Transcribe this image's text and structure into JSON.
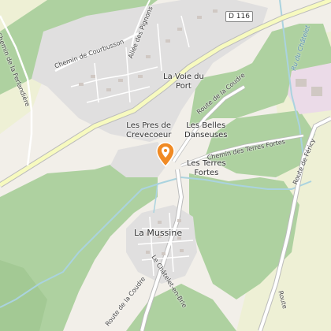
{
  "map": {
    "places": {
      "la_voie_du_port": "La Voie du\nPort",
      "les_pres_de_crevecoeur": "Les Pres de\nCrevecoeur",
      "les_belles_danseuses": "Les Belles\nDanseuses",
      "les_terres_fortes": "Les Terres\nFortes",
      "la_mussine": "La Mussine"
    },
    "roads": {
      "d116": "D 116",
      "chemin_ferlandiere": "Chemin de la Ferlandière",
      "allee_pignons": "Allée des Pignons",
      "chemin_courbusson": "Chemin de Courbusson",
      "route_coudre_upper": "Route de la Coudre",
      "route_coudre_lower": "Route de la Coudre",
      "chemin_terres_fortes": "Chemin des Terres Fortes",
      "route_fericy": "Route de Féricy",
      "le_chatelet": "Le Châtelet-en-Brie",
      "route_bottom_right": "Route"
    },
    "water": {
      "ru_chatelet": "Ru du Châtelet"
    },
    "icons": {
      "location_marker": "map-pin-icon"
    },
    "colors": {
      "forest": "#aed1a0",
      "background": "#f2efe9",
      "field": "#eef0d5",
      "residential": "#e0dfdf",
      "water": "#aad3df",
      "marker": "#f08a24",
      "road": "#ffffff",
      "road_major": "#f7fabf"
    }
  }
}
